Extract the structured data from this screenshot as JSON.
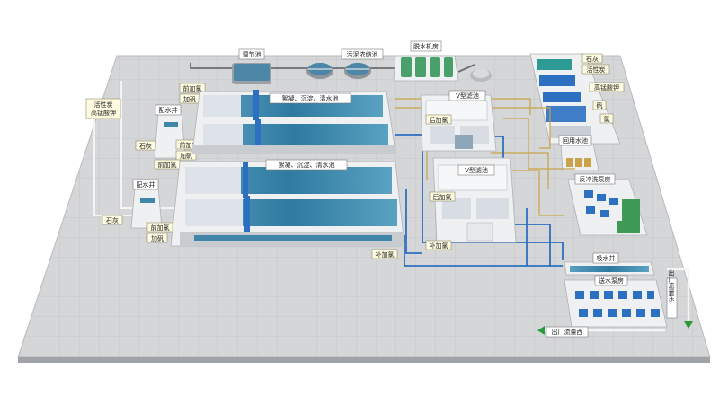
{
  "labels": {
    "regulating_tank": "调节池",
    "sludge_tank": "污泥浓缩池",
    "dewatering_room": "脱水机房",
    "lime_top": "石灰",
    "activated_carbon_top": "活性炭",
    "permanganate_top": "高锰酸钾",
    "alum_top": "矾",
    "chlorine_top": "氯",
    "recycle_pool": "回用水池",
    "backwash_pump": "反冲洗泵房",
    "suction_well": "吸水井",
    "delivery_pump": "送水泵房",
    "outlet_flow_west": "出厂流量西",
    "outlet_flow_east": "出厂流量东",
    "carbon_left_1": "活性炭",
    "carbon_left_2": "高锰酸钾",
    "mix_well_1": "配水井",
    "mix_well_2": "配水井",
    "lime_left_1": "石灰",
    "lime_left_2": "石灰",
    "pre_chlorine_1": "前加氯",
    "pre_chlorine_2": "前加氯",
    "pre_chlorine_3": "前加氯",
    "add_alum_1": "加矾",
    "add_alum_2": "加矾",
    "add_alum_3": "加矾",
    "coag_1": "絮凝、沉淀、清水池",
    "coag_2": "絮凝、沉淀、清水池",
    "vfilter_1": "V型滤池",
    "vfilter_2": "V型滤池",
    "post_chlorine_1": "后加氯",
    "post_chlorine_2": "后加氯",
    "supp_chlorine_1": "补加氯",
    "supp_chlorine_2": "补加氯"
  },
  "colors": {
    "ground": "#d5d6d8",
    "grid": "#bfc1c4",
    "building": "#eef0f2",
    "water": "#3f86a8",
    "blue_pipe": "#2d6fc0",
    "gold_pipe": "#c9a24a",
    "label_bg": "#fffbe0",
    "arrow": "#2b9a3a"
  }
}
